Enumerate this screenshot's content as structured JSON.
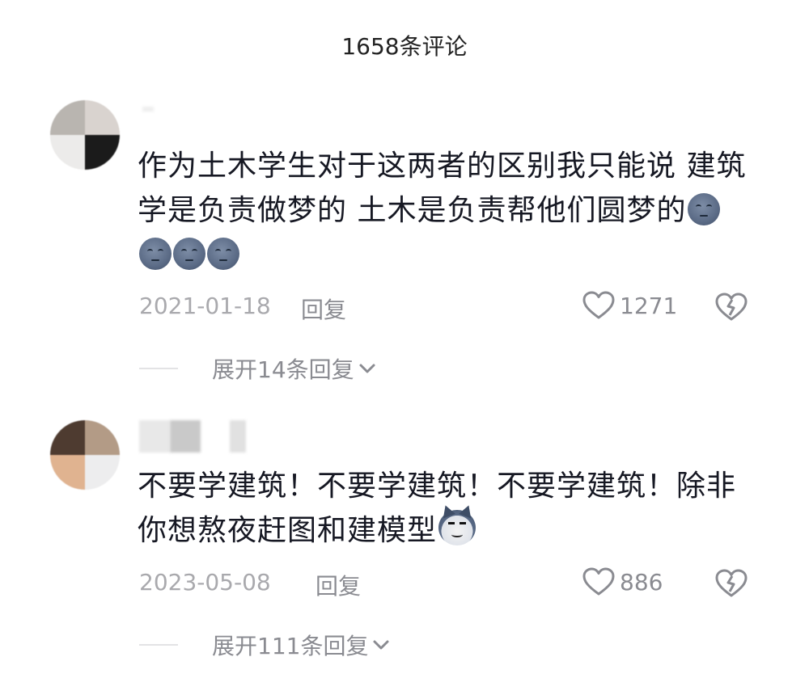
{
  "header": {
    "title": "1658条评论"
  },
  "comments": [
    {
      "text": "作为土木学生对于这两者的区别我只能说 建筑学是负责做梦的 土木是负责帮他们圆梦的",
      "trailing_emoji": "moon-face-emoji",
      "extra_emojis": [
        "moon-face-emoji",
        "moon-face-emoji",
        "moon-face-emoji"
      ],
      "date": "2021-01-18",
      "reply_label": "回复",
      "likes": "1271",
      "expand_label": "展开14条回复"
    },
    {
      "text": "不要学建筑！不要学建筑！不要学建筑！除非你想熬夜赶图和建模型",
      "trailing_emoji": "husky-emoji",
      "date": "2023-05-08",
      "reply_label": "回复",
      "likes": "886",
      "expand_label": "展开111条回复"
    }
  ],
  "colors": {
    "text": "#161823",
    "meta": "#a9a9ad",
    "icon": "#8a8b91"
  }
}
